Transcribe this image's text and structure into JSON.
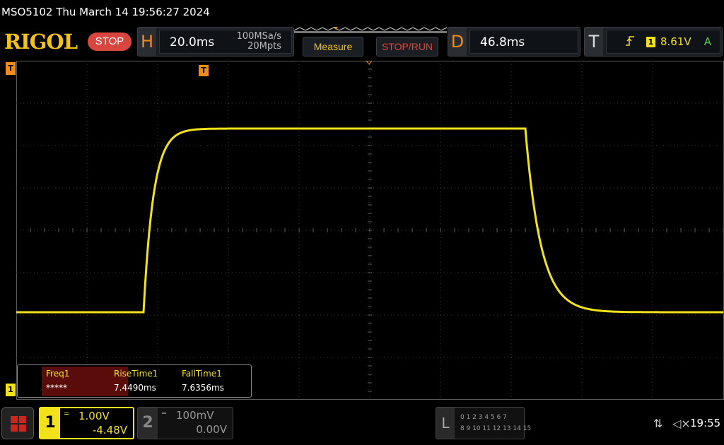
{
  "titlebar": {
    "text": "MSO5102  Thu March 14 19:56:27 2024"
  },
  "brand": {
    "logo": "RIGOL",
    "run_state": "STOP"
  },
  "horizontal": {
    "letter": "H",
    "timebase": "20.0ms",
    "sample_rate": "100MSa/s",
    "memory_depth": "20Mpts"
  },
  "buttons": {
    "measure": "Measure",
    "stop_run": "STOP/RUN"
  },
  "delay": {
    "letter": "D",
    "value": "46.8ms"
  },
  "trigger": {
    "letter": "T",
    "edge_icon": "rising-edge-icon",
    "source": "1",
    "level": "8.61V",
    "mode": "A"
  },
  "markers": {
    "ch1": "1",
    "trigger_position": "T",
    "trigger_time": "T"
  },
  "measurements": [
    {
      "name": "Freq1",
      "value": "*****"
    },
    {
      "name": "RiseTime1",
      "value": "7.4490ms"
    },
    {
      "name": "FallTime1",
      "value": "7.6356ms"
    }
  ],
  "channel1": {
    "number": "1",
    "scale": "1.00V",
    "offset": "-4.48V",
    "color": "#f2e21b"
  },
  "channel2": {
    "number": "2",
    "scale": "100mV",
    "offset": "0.00V",
    "color": "#999999"
  },
  "logic_analyzer": {
    "letter": "L",
    "row1": "0 1 2 3   4 5 6 7",
    "row2": "8 9 10 11  12 13 14 15"
  },
  "status": {
    "usb_icon": "usb-icon",
    "speaker_icon": "speaker-muted-icon",
    "time": "19:55"
  },
  "colors": {
    "accent": "#f08c1d",
    "trace": "#f2e21b",
    "stop": "#d8463f"
  }
}
